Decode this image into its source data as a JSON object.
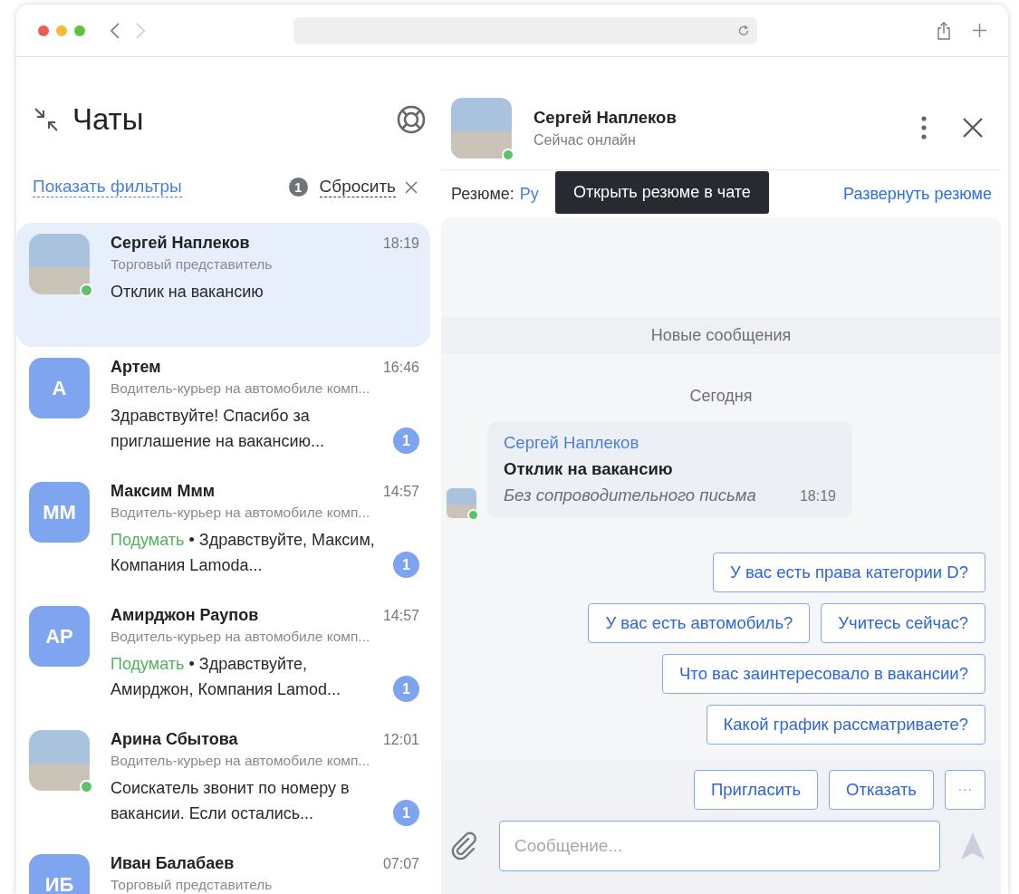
{
  "sidebar": {
    "title": "Чаты",
    "show_filters": "Показать фильтры",
    "filter_count": "1",
    "reset": "Сбросить"
  },
  "chats": [
    {
      "name": "Сергей Наплеков",
      "time": "18:19",
      "subtitle": "Торговый представитель",
      "preview": "Отклик на вакансию",
      "avatar": {
        "kind": "photo"
      },
      "online": true,
      "selected": true
    },
    {
      "name": "Артем",
      "time": "16:46",
      "subtitle": "Водитель-курьер на автомобиле комп...",
      "preview": "Здравствуйте! Спасибо за приглашение на вакансию...",
      "avatar": {
        "kind": "initials",
        "initials": "А"
      },
      "online": false,
      "selected": false,
      "unread": "1"
    },
    {
      "name": "Максим Ммм",
      "time": "14:57",
      "subtitle": "Водитель-курьер на автомобиле комп...",
      "status": "Подумать",
      "preview": "• Здравствуйте, Максим, Компания Lamoda...",
      "avatar": {
        "kind": "initials",
        "initials": "ММ"
      },
      "online": false,
      "selected": false,
      "unread": "1"
    },
    {
      "name": "Амирджон Раупов",
      "time": "14:57",
      "subtitle": "Водитель-курьер на автомобиле комп...",
      "status": "Подумать",
      "preview": "• Здравствуйте, Амирджон, Компания Lamod...",
      "avatar": {
        "kind": "initials",
        "initials": "АР"
      },
      "online": false,
      "selected": false,
      "unread": "1"
    },
    {
      "name": "Арина Сбытова",
      "time": "12:01",
      "subtitle": "Водитель-курьер на автомобиле комп...",
      "preview": "Соискатель звонит по номеру в вакансии. Если остались...",
      "avatar": {
        "kind": "photo"
      },
      "online": true,
      "selected": false,
      "unread": "1"
    },
    {
      "name": "Иван Балабаев",
      "time": "07:07",
      "subtitle": "Торговый представитель",
      "avatar": {
        "kind": "initials",
        "initials": "ИБ"
      },
      "online": false,
      "selected": false
    }
  ],
  "chat": {
    "name": "Сергей Наплеков",
    "status": "Сейчас онлайн",
    "online": true,
    "resume_label": "Резюме:",
    "resume_link": "Ру",
    "expand_resume": "Развернуть резюме",
    "tooltip": "Открыть резюме в чате",
    "new_messages": "Новые сообщения",
    "date": "Сегодня",
    "message": {
      "sender": "Сергей Наплеков",
      "title": "Отклик на вакансию",
      "text": "Без сопроводительного письма",
      "time": "18:19",
      "online": true
    },
    "quick_replies": [
      [
        "У вас есть права категории D?"
      ],
      [
        "У вас есть автомобиль?",
        "Учитесь сейчас?"
      ],
      [
        "Что вас заинтересовало в вакансии?"
      ],
      [
        "Какой график рассматриваете?"
      ]
    ],
    "actions": [
      "Пригласить",
      "Отказать"
    ],
    "more": "···",
    "input": {
      "placeholder": "Сообщение..."
    }
  }
}
